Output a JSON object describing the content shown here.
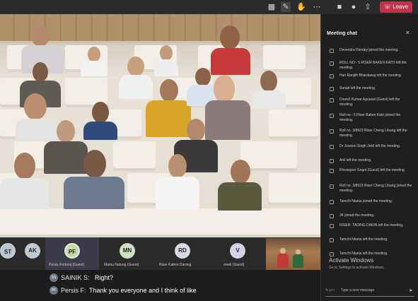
{
  "toolbar": {
    "icons": [
      "participants-icon",
      "chat-icon",
      "raise-hand-icon",
      "more-icon",
      "camera-icon",
      "mic-icon",
      "share-icon"
    ],
    "leave_label": "Leave"
  },
  "chat": {
    "title": "Meeting chat",
    "messages": [
      "Devendra Pandey joined the meeting.",
      "ROLL NO:- 5 RISER BAKEN KATO left the meeting.",
      "Hari Ranjith Bhardawaj left the meeting.",
      "Surajit left the meeting.",
      "Dinesh Kumar Agrawal (Guest) left the meeting.",
      "Roll no - 5 Riser Baken Kato joined the meeting.",
      "Roll no. 3/8923 Riser Cheng Libang left the meeting.",
      "Dr Jowson Singh Jekil left the meeting.",
      "Anil left the meeting.",
      "Khwanjeet Gogoi (Guest) left the meeting.",
      "Roll no. 3/8923 Riser Cheng Libang joined the meeting.",
      "Tamchi Nlania joined the meeting.",
      "JK joined the meeting.",
      "RISER- TADING DAKIN left the meeting.",
      "Tamchi Nlania left the meeting.",
      "Tamchi Nlania left the meeting."
    ],
    "watermark_title": "Activate Windows",
    "watermark_sub": "Go to Settings to activate Windows.",
    "compose_placeholder": "Type a new message"
  },
  "participants": [
    {
      "initials": "ST",
      "name": "",
      "color": "#b9c6d6"
    },
    {
      "initials": "AK",
      "name": "",
      "color": "#c2c9d3"
    },
    {
      "initials": "PF",
      "name": "Persis Fortooij (Guest)",
      "color": "#c7d8a6"
    },
    {
      "initials": "MN",
      "name": "Mamu Natung (Guest)",
      "color": "#cfe2c0"
    },
    {
      "initials": "RD",
      "name": "Riser Katem Darang",
      "color": "#d6d8e3"
    },
    {
      "initials": "V",
      "name": "vivek (Guest)",
      "color": "#d4d0e8"
    }
  ],
  "captions": [
    {
      "initials": "SS",
      "speaker": "SAINIK S:",
      "text": "Right?"
    },
    {
      "initials": "PF",
      "speaker": "Persis F:",
      "text": "Thank you everyone and I think of like"
    }
  ]
}
